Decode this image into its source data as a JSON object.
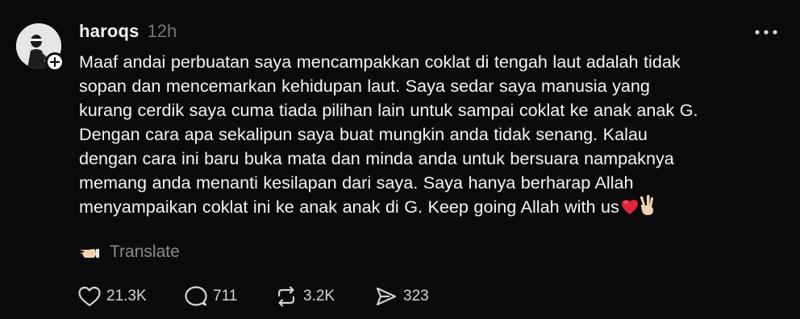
{
  "post": {
    "username": "haroqs",
    "timestamp": "12h",
    "text_lines": [
      "Maaf andai perbuatan saya mencampakkan coklat di tengah laut adalah tidak",
      "sopan dan mencemarkan kehidupan laut. Saya sedar saya manusia yang",
      "kurang cerdik saya cuma tiada pilihan lain untuk sampai coklat ke anak anak G.",
      "Dengan cara apa sekalipun saya buat mungkin anda tidak senang. Kalau",
      "dengan cara ini baru buka mata dan minda anda untuk bersuara nampaknya",
      "memang anda menanti kesilapan dari saya. Saya hanya berharap Allah",
      "menyampaikan coklat ini ke anak anak di G. Keep going Allah with us"
    ],
    "translate_label": "Translate",
    "stats": {
      "likes": "21.3K",
      "replies": "711",
      "reposts": "3.2K",
      "shares": "323"
    }
  },
  "icons": {
    "avatar": "profile-photo",
    "follow": "plus-icon",
    "more": "more-horizontal-icon",
    "translate": "pointing-hand-icon",
    "like": "heart-icon",
    "reply": "speech-bubble-icon",
    "repost": "repost-icon",
    "share": "send-icon",
    "emoji_end": [
      "red-heart-emoji",
      "victory-hand-emoji"
    ]
  },
  "colors": {
    "background": "#0a0a0a",
    "text_primary": "#f3f5f7",
    "text_secondary": "#777777",
    "heart_emoji": "#e0263b"
  }
}
